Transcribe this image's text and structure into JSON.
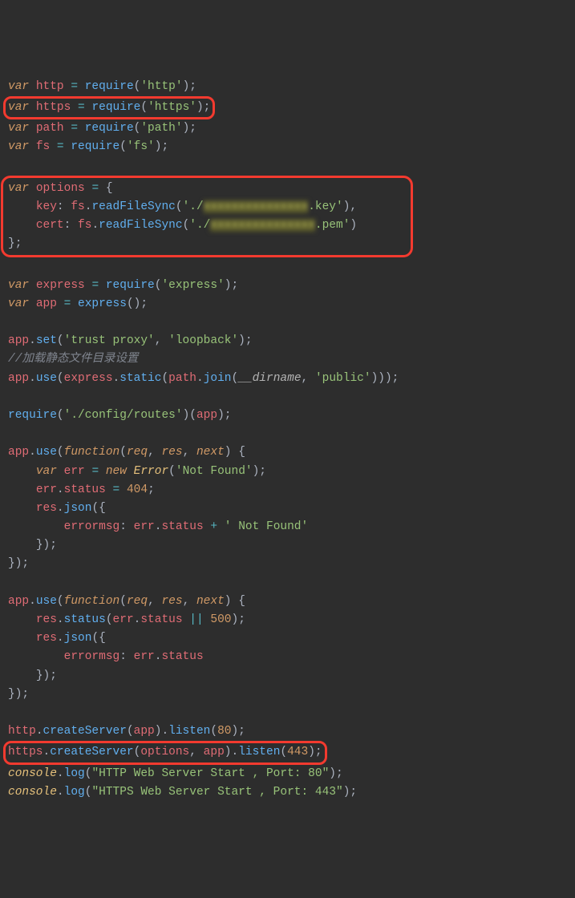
{
  "language": "javascript",
  "highlights": [
    "var https = require('https');",
    "var options = { key: fs.readFileSync('./xxxxxxxx.key'), cert: fs.readFileSync('./xxxxxxxx.pem') };",
    "https.createServer(options, app).listen(443);"
  ],
  "tokens": {
    "l1": {
      "kw": "var",
      "v": "http",
      "fn": "require",
      "a": "'http'"
    },
    "l2": {
      "kw": "var",
      "v": "https",
      "fn": "require",
      "a": "'https'"
    },
    "l3": {
      "kw": "var",
      "v": "path",
      "fn": "require",
      "a": "'path'"
    },
    "l4": {
      "kw": "var",
      "v": "fs",
      "fn": "require",
      "a": "'fs'"
    },
    "l6": {
      "kw": "var",
      "v": "options"
    },
    "l7": {
      "k": "key",
      "o": "fs",
      "fn": "readFileSync",
      "s1": "'./",
      "ob": "xxxxxxxxxxxxxxx",
      "s2": ".key'"
    },
    "l8": {
      "k": "cert",
      "o": "fs",
      "fn": "readFileSync",
      "s1": "'./",
      "ob": "xxxxxxxxxxxxxxx",
      "s2": ".pem'"
    },
    "l11": {
      "kw": "var",
      "v": "express",
      "fn": "require",
      "a": "'express'"
    },
    "l12": {
      "kw": "var",
      "v": "app",
      "fn": "express"
    },
    "l14": {
      "o": "app",
      "fn": "set",
      "a1": "'trust proxy'",
      "a2": "'loopback'"
    },
    "l15": {
      "cmt": "//加载静态文件目录设置"
    },
    "l16": {
      "o": "app",
      "fn1": "use",
      "o2": "express",
      "fn2": "static",
      "o3": "path",
      "fn3": "join",
      "d": "__dirname",
      "a": "'public'"
    },
    "l18": {
      "fn": "require",
      "a": "'./config/routes'",
      "v": "app"
    },
    "l20": {
      "o": "app",
      "fn": "use",
      "kw": "function",
      "p": [
        "req",
        "res",
        "next"
      ]
    },
    "l21": {
      "kw": "var",
      "v": "err",
      "op": "=",
      "kw2": "new",
      "cls": "Error",
      "a": "'Not Found'"
    },
    "l22": {
      "o": "err",
      "p": "status",
      "op": "=",
      "n": "404"
    },
    "l23": {
      "o": "res",
      "fn": "json"
    },
    "l24": {
      "k": "errormsg",
      "o": "err",
      "p": "status",
      "op": "+",
      "s": "' Not Found'"
    },
    "l28": {
      "o": "app",
      "fn": "use",
      "kw": "function",
      "p": [
        "req",
        "res",
        "next"
      ]
    },
    "l29": {
      "o": "res",
      "fn": "status",
      "o2": "err",
      "p": "status",
      "op": "||",
      "n": "500"
    },
    "l30": {
      "o": "res",
      "fn": "json"
    },
    "l31": {
      "k": "errormsg",
      "o": "err",
      "p": "status"
    },
    "l35": {
      "o": "http",
      "fn": "createServer",
      "a": "app",
      "fn2": "listen",
      "n": "80"
    },
    "l36": {
      "o": "https",
      "fn": "createServer",
      "a1": "options",
      "a2": "app",
      "fn2": "listen",
      "n": "443"
    },
    "l37": {
      "o": "console",
      "fn": "log",
      "s": "\"HTTP Web Server Start , Port: 80\""
    },
    "l38": {
      "o": "console",
      "fn": "log",
      "s": "\"HTTPS Web Server Start , Port: 443\""
    }
  }
}
